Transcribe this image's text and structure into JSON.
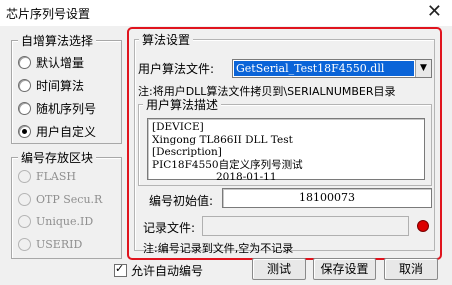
{
  "window": {
    "title": "芯片序列号设置",
    "close_symbol": "✕"
  },
  "algo_select": {
    "title": "自增算法选择",
    "options": [
      {
        "label": "默认增量",
        "checked": false
      },
      {
        "label": "时间算法",
        "checked": false
      },
      {
        "label": "随机序列号",
        "checked": false
      },
      {
        "label": "用户自定义",
        "checked": true
      }
    ]
  },
  "storage": {
    "title": "编号存放区块",
    "options": [
      {
        "label": "FLASH"
      },
      {
        "label": "OTP Secu.R"
      },
      {
        "label": "Unique.ID"
      },
      {
        "label": "USERID"
      }
    ]
  },
  "algo_settings": {
    "title": "算法设置",
    "file_label": "用户算法文件:",
    "file_value": "GetSerial_Test18F4550.dll",
    "note": "注:将用户DLL算法文件拷贝到\\SERIALNUMBER目录",
    "desc_title": "用户算法描述",
    "desc_lines": [
      "[DEVICE]",
      "Xingong TL866II DLL Test",
      "[Description]",
      "PIC18F4550自定义序列号测试",
      "2018-01-11"
    ],
    "initial_label": "编号初始值:",
    "initial_value": "18100073"
  },
  "record": {
    "label": "记录文件:",
    "value": "",
    "note": "注:编号记录到文件,空为不记录"
  },
  "footer": {
    "auto_number_label": "允许自动编号",
    "auto_number_checked": true,
    "test_button": "测试",
    "save_button": "保存设置",
    "cancel_button": "取消"
  },
  "colors": {
    "highlight": "#e0141e",
    "selection": "#0a64d8",
    "record_dot": "#dc0000"
  }
}
